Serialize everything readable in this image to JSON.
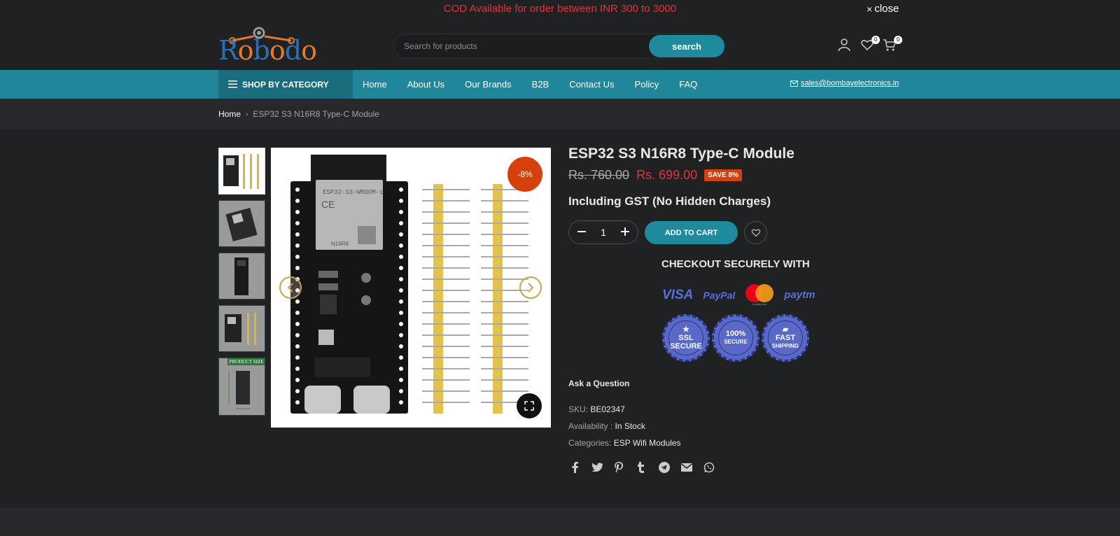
{
  "announcement": {
    "message": "COD Available for order between INR 300 to 3000",
    "close_label": "close"
  },
  "header": {
    "logo_text": "Robodo",
    "search": {
      "placeholder": "Search for products",
      "button_label": "search"
    },
    "wishlist_count": "0",
    "cart_count": "0"
  },
  "nav": {
    "shop_by_category": "SHOP BY CATEGORY",
    "items": [
      "Home",
      "About Us",
      "Our Brands",
      "B2B",
      "Contact Us",
      "Policy",
      "FAQ"
    ],
    "email": "sales@bombayelectronics.in"
  },
  "breadcrumb": {
    "home": "Home",
    "current": "ESP32 S3 N16R8 Type-C Module"
  },
  "gallery": {
    "thumbnail_count": 5,
    "discount_badge": "-8%",
    "thumb_labels": [
      "",
      "",
      "",
      "",
      "PRODUCT SIZE"
    ]
  },
  "product": {
    "title": "ESP32 S3 N16R8 Type-C Module",
    "old_price": "Rs. 760.00",
    "new_price": "Rs. 699.00",
    "save_badge": "SAVE 8%",
    "gst_note": "Including GST (No Hidden Charges)",
    "quantity": "1",
    "add_to_cart": "ADD TO CART",
    "checkout_heading": "CHECKOUT SECURELY WITH",
    "payment_methods": [
      "VISA",
      "PayPal",
      "mastercard",
      "paytm"
    ],
    "seals": [
      {
        "line1": "SSL",
        "line2": "SECURE"
      },
      {
        "line1": "100%",
        "line2": "SECURE"
      },
      {
        "line1": "FAST",
        "line2": "SHIPPING"
      }
    ],
    "ask_question": "Ask a Question",
    "sku_label": "SKU:",
    "sku_value": "BE02347",
    "availability_label": "Availability :",
    "availability_value": "In Stock",
    "categories_label": "Categories:",
    "categories_value": "ESP Wifi Modules"
  },
  "social_icons": [
    "facebook-icon",
    "twitter-icon",
    "pinterest-icon",
    "tumblr-icon",
    "telegram-icon",
    "email-icon",
    "whatsapp-icon"
  ],
  "colors": {
    "background": "#1f2123",
    "accent_teal": "#1f8799",
    "sale_red": "#e2353d",
    "badge_orange": "#d5400c",
    "announcement_red": "#e8323a"
  }
}
